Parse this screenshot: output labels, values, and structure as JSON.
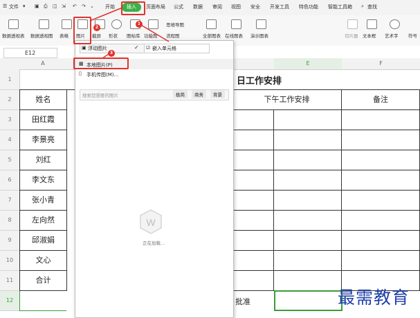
{
  "menu": {
    "file": "文件",
    "tabs": [
      "开始",
      "插入",
      "页面布局",
      "公式",
      "数据",
      "审阅",
      "视图",
      "安全",
      "开发工具",
      "特色功能",
      "智能工具箱"
    ],
    "active_tab": "插入",
    "search": "查找"
  },
  "ribbon": {
    "items": [
      "数据透视表",
      "数据透视图",
      "表格",
      "图片",
      "截屏",
      "形状",
      "图标库",
      "功能图",
      "思维导图",
      "流程图",
      "全部图表",
      "在线图表",
      "演示图表",
      "切片器",
      "文本框",
      "艺术字",
      "符号"
    ]
  },
  "formula_bar": {
    "cell_ref": "E12"
  },
  "columns": [
    "A",
    "E",
    "F"
  ],
  "rows": [
    "1",
    "2",
    "3",
    "4",
    "5",
    "6",
    "7",
    "8",
    "9",
    "10",
    "11",
    "12"
  ],
  "sheet": {
    "title_fragment": "日工作安排",
    "headers": {
      "name": "姓名",
      "afternoon": "下午工作安排",
      "note": "备注"
    },
    "names": [
      "田红霞",
      "李景亮",
      "刘红",
      "李文东",
      "张小青",
      "左向然",
      "邱淑娟",
      "文心",
      "合计"
    ],
    "row12_fragment": "批准"
  },
  "dropdown": {
    "float_option": "浮动图片",
    "embed_option": "嵌入单元格",
    "local_picture": "本地图片(P)",
    "phone_picture": "手机传图(M)...",
    "search_placeholder": "搜索您想要的图片",
    "filters": [
      "极简",
      "商务",
      "背景"
    ],
    "loading": "正在加载..."
  },
  "callouts": [
    "1",
    "2",
    "3"
  ],
  "watermark": "最需教育",
  "colors": {
    "highlight": "#e0322d",
    "active_tab": "#3bb14a",
    "selection": "#3b9b3b"
  }
}
